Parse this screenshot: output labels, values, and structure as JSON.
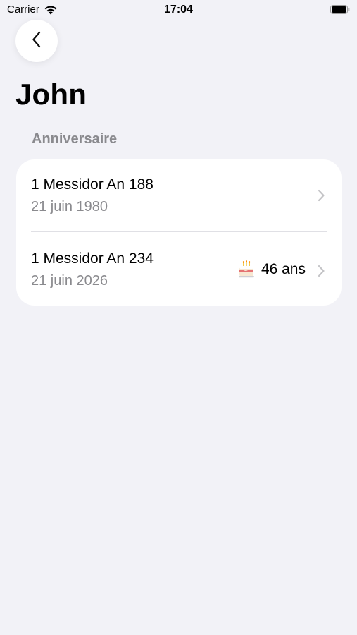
{
  "status_bar": {
    "carrier": "Carrier",
    "time": "17:04",
    "icons": [
      "wifi-icon",
      "battery-icon"
    ]
  },
  "nav": {
    "back_icon": "chevron-left-icon"
  },
  "page": {
    "title": "John"
  },
  "section": {
    "header": "Anniversaire",
    "rows": [
      {
        "primary": "1 Messidor An 188",
        "secondary": "21 juin 1980",
        "age": null
      },
      {
        "primary": "1 Messidor An 234",
        "secondary": "21 juin 2026",
        "age": "46 ans",
        "age_icon": "birthday-cake-icon"
      }
    ]
  },
  "colors": {
    "background": "#f2f2f7",
    "card": "#ffffff",
    "secondary_text": "#8a8a8e",
    "chevron": "#c4c4c7"
  }
}
